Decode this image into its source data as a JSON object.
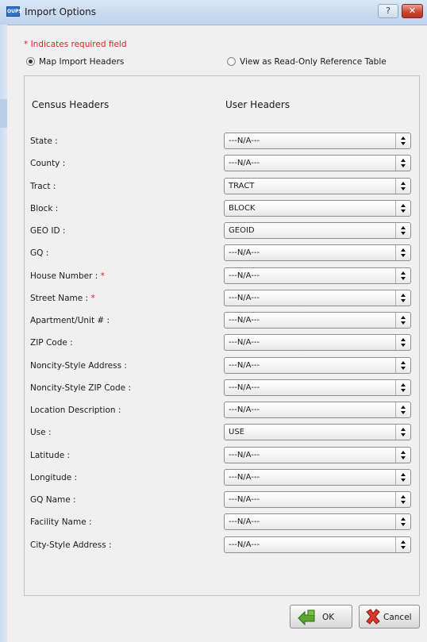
{
  "window": {
    "title": "Import Options",
    "app_icon_text": "OUPS",
    "help_label": "?",
    "close_label": "✕"
  },
  "required_note": "* Indicates required field",
  "mode": {
    "option_map": "Map Import Headers",
    "option_readonly": "View as Read-Only Reference Table",
    "selected": "Map Import Headers"
  },
  "headers": {
    "census": "Census Headers",
    "user": "User Headers"
  },
  "rows": [
    {
      "label": "State :",
      "required": false,
      "value": "---N/A---"
    },
    {
      "label": "County :",
      "required": false,
      "value": "---N/A---"
    },
    {
      "label": "Tract :",
      "required": false,
      "value": "TRACT"
    },
    {
      "label": "Block :",
      "required": false,
      "value": "BLOCK"
    },
    {
      "label": "GEO ID :",
      "required": false,
      "value": "GEOID"
    },
    {
      "label": "GQ :",
      "required": false,
      "value": "---N/A---"
    },
    {
      "label": "House Number :",
      "required": true,
      "value": "---N/A---"
    },
    {
      "label": "Street Name :",
      "required": true,
      "value": "---N/A---"
    },
    {
      "label": "Apartment/Unit # :",
      "required": false,
      "value": "---N/A---"
    },
    {
      "label": "ZIP Code :",
      "required": false,
      "value": "---N/A---"
    },
    {
      "label": "Noncity-Style Address :",
      "required": false,
      "value": "---N/A---"
    },
    {
      "label": "Noncity-Style ZIP Code :",
      "required": false,
      "value": "---N/A---"
    },
    {
      "label": "Location Description :",
      "required": false,
      "value": "---N/A---"
    },
    {
      "label": "Use :",
      "required": false,
      "value": "USE"
    },
    {
      "label": "Latitude :",
      "required": false,
      "value": "---N/A---"
    },
    {
      "label": "Longitude :",
      "required": false,
      "value": "---N/A---"
    },
    {
      "label": "GQ Name :",
      "required": false,
      "value": "---N/A---"
    },
    {
      "label": "Facility Name :",
      "required": false,
      "value": "---N/A---"
    },
    {
      "label": "City-Style Address :",
      "required": false,
      "value": "---N/A---"
    }
  ],
  "required_marker": "*",
  "buttons": {
    "ok": "OK",
    "cancel": "Cancel"
  },
  "icons": {
    "ok": "green-arrow-icon",
    "cancel": "red-x-icon",
    "app": "oups-app-icon"
  },
  "colors": {
    "required": "#e02020",
    "titlebar": "#c9dbef"
  }
}
